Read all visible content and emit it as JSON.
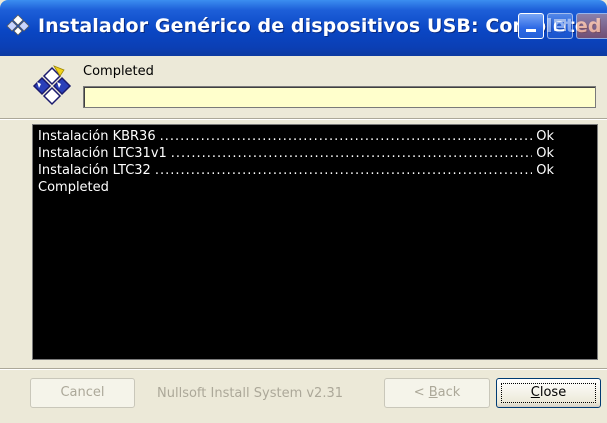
{
  "window": {
    "title": "Instalador Genérico de dispositivos USB: Completed",
    "title_buttons": [
      "minimize",
      "maximize",
      "close"
    ]
  },
  "header": {
    "status_label": "Completed",
    "progress_percent": 100,
    "logo_icon": "nsis-installer-icon"
  },
  "log": {
    "rows": [
      {
        "name": "Instalación KBR36",
        "status": "Ok"
      },
      {
        "name": "Instalación LTC31v1",
        "status": "Ok"
      },
      {
        "name": "Instalación LTC32",
        "status": "Ok"
      }
    ],
    "final_line": "Completed"
  },
  "footer": {
    "cancel_label": "Cancel",
    "branding": "Nullsoft Install System v2.31",
    "back_label_prefix": "< ",
    "back_label_mnemonic": "B",
    "back_label_rest": "ack",
    "close_label_mnemonic": "C",
    "close_label_rest": "lose"
  },
  "colors": {
    "titlebar": "#0a46c4",
    "progress_fill": "#ffffcc",
    "log_background": "#000000",
    "window_face": "#ece9d8"
  }
}
